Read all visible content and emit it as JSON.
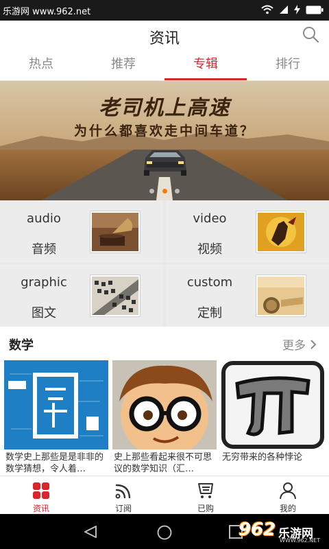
{
  "status_bar": {
    "watermark": "乐游网 www.962.net",
    "icons": [
      "wifi-icon",
      "signal-icon",
      "charging-icon",
      "battery-icon"
    ]
  },
  "header": {
    "title": "资讯",
    "search_icon": "search-icon"
  },
  "tabs": [
    {
      "label": "热点",
      "active": false
    },
    {
      "label": "推荐",
      "active": false
    },
    {
      "label": "专辑",
      "active": true
    },
    {
      "label": "排行",
      "active": false
    }
  ],
  "banner": {
    "headline": "老司机上高速",
    "subline": "为什么都喜欢走中间车道？",
    "slide_count": 3,
    "active_slide": 2
  },
  "categories": [
    {
      "en": "audio",
      "zh": "音频",
      "thumb": "gramophone-image"
    },
    {
      "en": "video",
      "zh": "视频",
      "thumb": "shadow-puppet-image"
    },
    {
      "en": "graphic",
      "zh": "图文",
      "thumb": "typography-image"
    },
    {
      "en": "custom",
      "zh": "定制",
      "thumb": "vintage-paper-image"
    }
  ],
  "section": {
    "title": "数学",
    "more_label": "更多"
  },
  "cards": [
    {
      "caption": "数学史上那些是是非非的数学猜想，令人着…",
      "image": "math-chalkboard-image"
    },
    {
      "caption": "史上那些看起来很不可思议的数学知识（汇…",
      "image": "cartoon-glasses-image"
    },
    {
      "caption": "无穷带来的各种悖论",
      "image": "pi-symbol-image"
    }
  ],
  "bottom_nav": [
    {
      "label": "资讯",
      "icon": "grid-icon",
      "active": true
    },
    {
      "label": "订阅",
      "icon": "rss-icon",
      "active": false
    },
    {
      "label": "已购",
      "icon": "cart-icon",
      "active": false
    },
    {
      "label": "我的",
      "icon": "person-icon",
      "active": false
    }
  ],
  "system_nav": {
    "watermark_number": "962",
    "watermark_brand": "乐游网",
    "watermark_url": "WWW.962.NET"
  },
  "colors": {
    "accent": "#d9262c",
    "status_bar": "#1a1a1a",
    "grid_bg": "#ececec",
    "dot_active": "#ff7a00"
  }
}
